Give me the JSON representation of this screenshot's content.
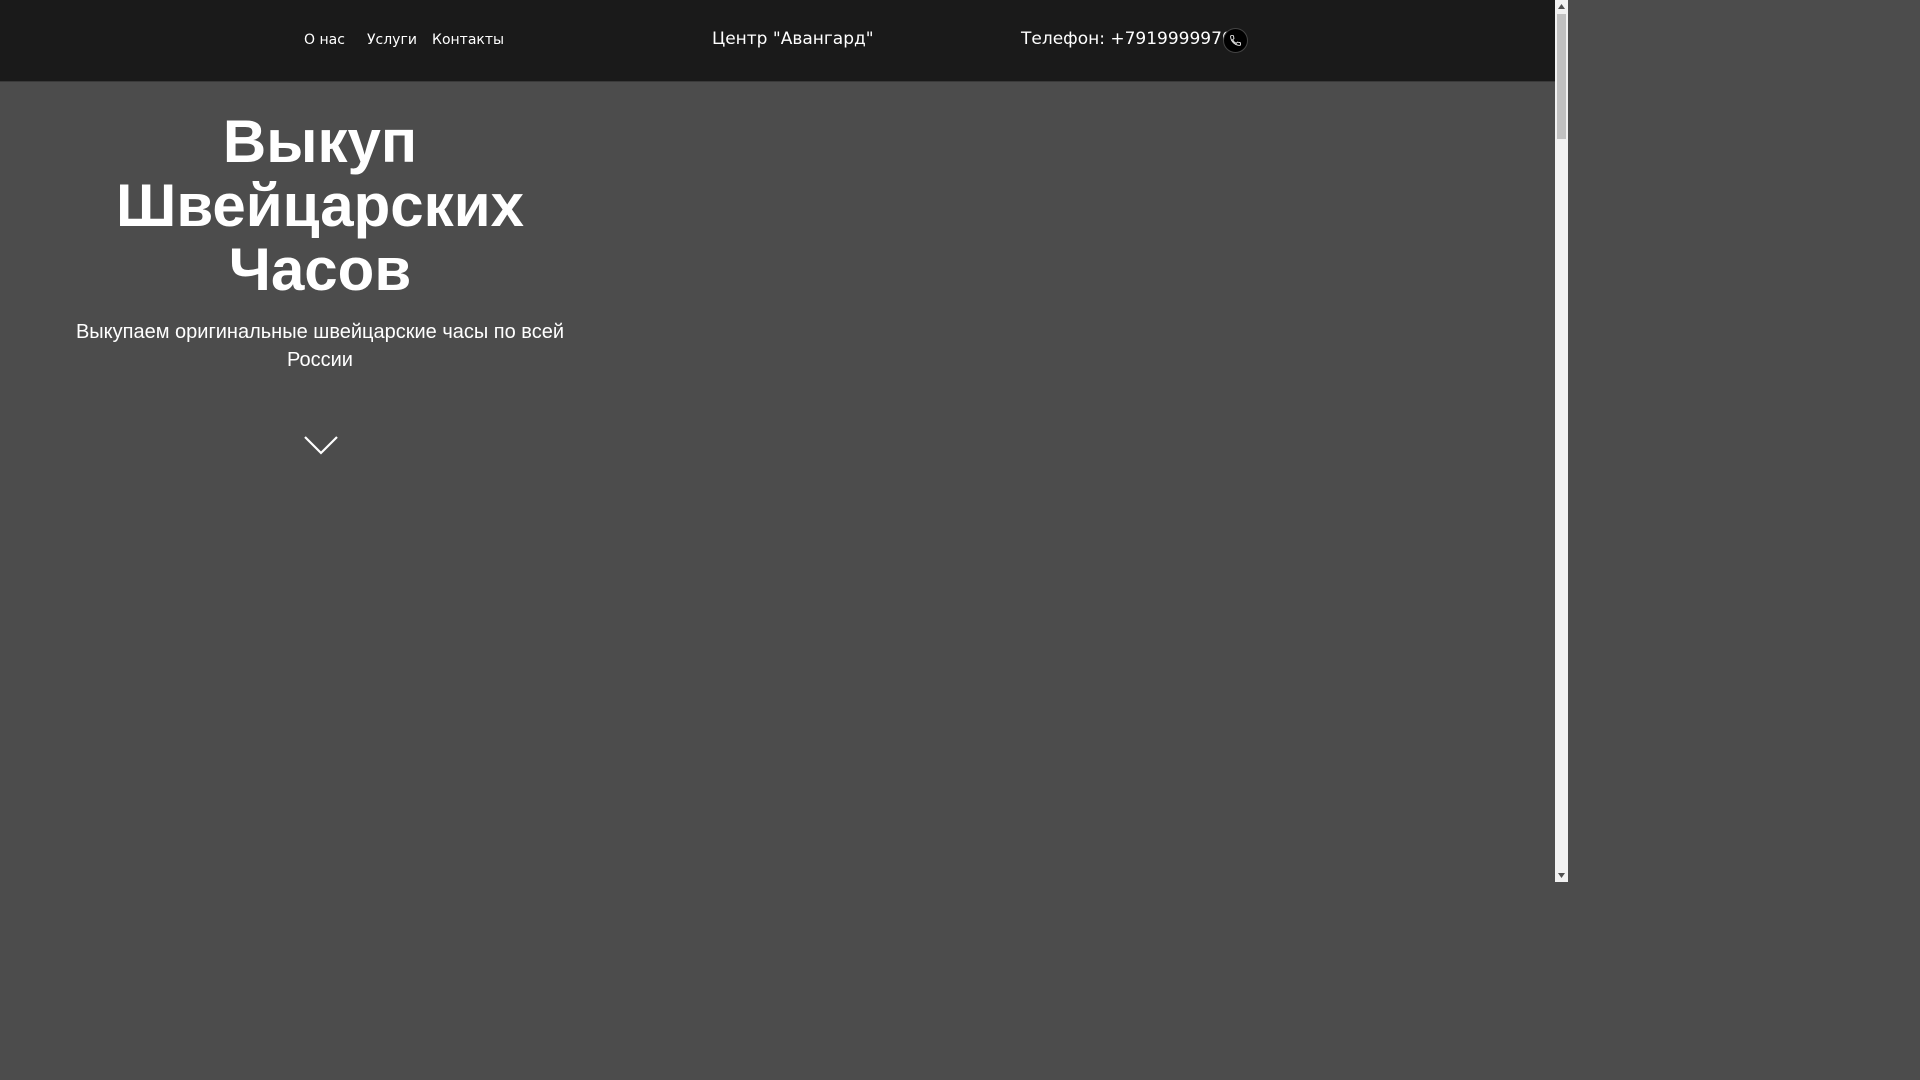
{
  "nav": {
    "items": [
      {
        "label": "О нас"
      },
      {
        "label": "Услуги"
      },
      {
        "label": "Контакты"
      }
    ]
  },
  "brand": {
    "title": "Центр \"Авангард\""
  },
  "contact": {
    "phone_text": "Телефон: +79199999700",
    "call_icon": "phone-icon"
  },
  "hero": {
    "title": "Выкуп Швейцарских Часов",
    "subtitle": "Выкупаем оригинальные швейцарские часы по всей России",
    "scroll_icon": "chevron-down-icon"
  },
  "colors": {
    "header_bg": "#1a1a1a",
    "hero_bg": "#4c4c4c",
    "text": "#ffffff"
  }
}
